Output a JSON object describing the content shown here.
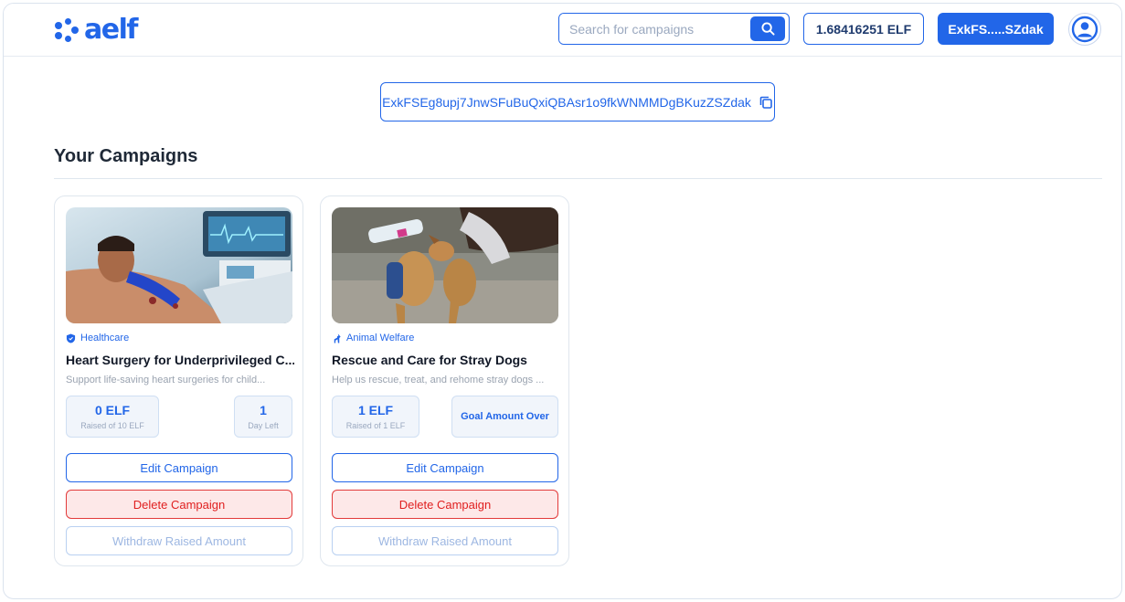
{
  "brand": {
    "name": "aelf",
    "color": "#2266e8"
  },
  "header": {
    "search": {
      "placeholder": "Search for campaigns",
      "icon": "search-icon"
    },
    "balance_label": "1.68416251 ELF",
    "wallet_label": "ExkFS.....SZdak",
    "avatar_icon": "user-circle-icon"
  },
  "address": {
    "full": "ExkFSEg8upj7JnwSFuBuQxiQBAsr1o9fkWNMMDgBKuzZSZdak",
    "icon": "copy-icon"
  },
  "section_title": "Your Campaigns",
  "campaigns": [
    {
      "category": "Healthcare",
      "category_icon": "shield-icon",
      "title": "Heart Surgery for Underprivileged C...",
      "description": "Support life-saving heart surgeries for child...",
      "raised_value": "0 ELF",
      "raised_sub": "Raised of 10 ELF",
      "days_value": "1",
      "days_sub": "Day Left",
      "edit_label": "Edit Campaign",
      "delete_label": "Delete Campaign",
      "withdraw_label": "Withdraw Raised Amount"
    },
    {
      "category": "Animal Welfare",
      "category_icon": "deer-icon",
      "title": "Rescue and Care for Stray Dogs",
      "description": "Help us rescue, treat, and rehome stray dogs ...",
      "raised_value": "1 ELF",
      "raised_sub": "Raised of 1 ELF",
      "goal_label": "Goal Amount Over",
      "edit_label": "Edit Campaign",
      "delete_label": "Delete Campaign",
      "withdraw_label": "Withdraw Raised Amount"
    }
  ]
}
